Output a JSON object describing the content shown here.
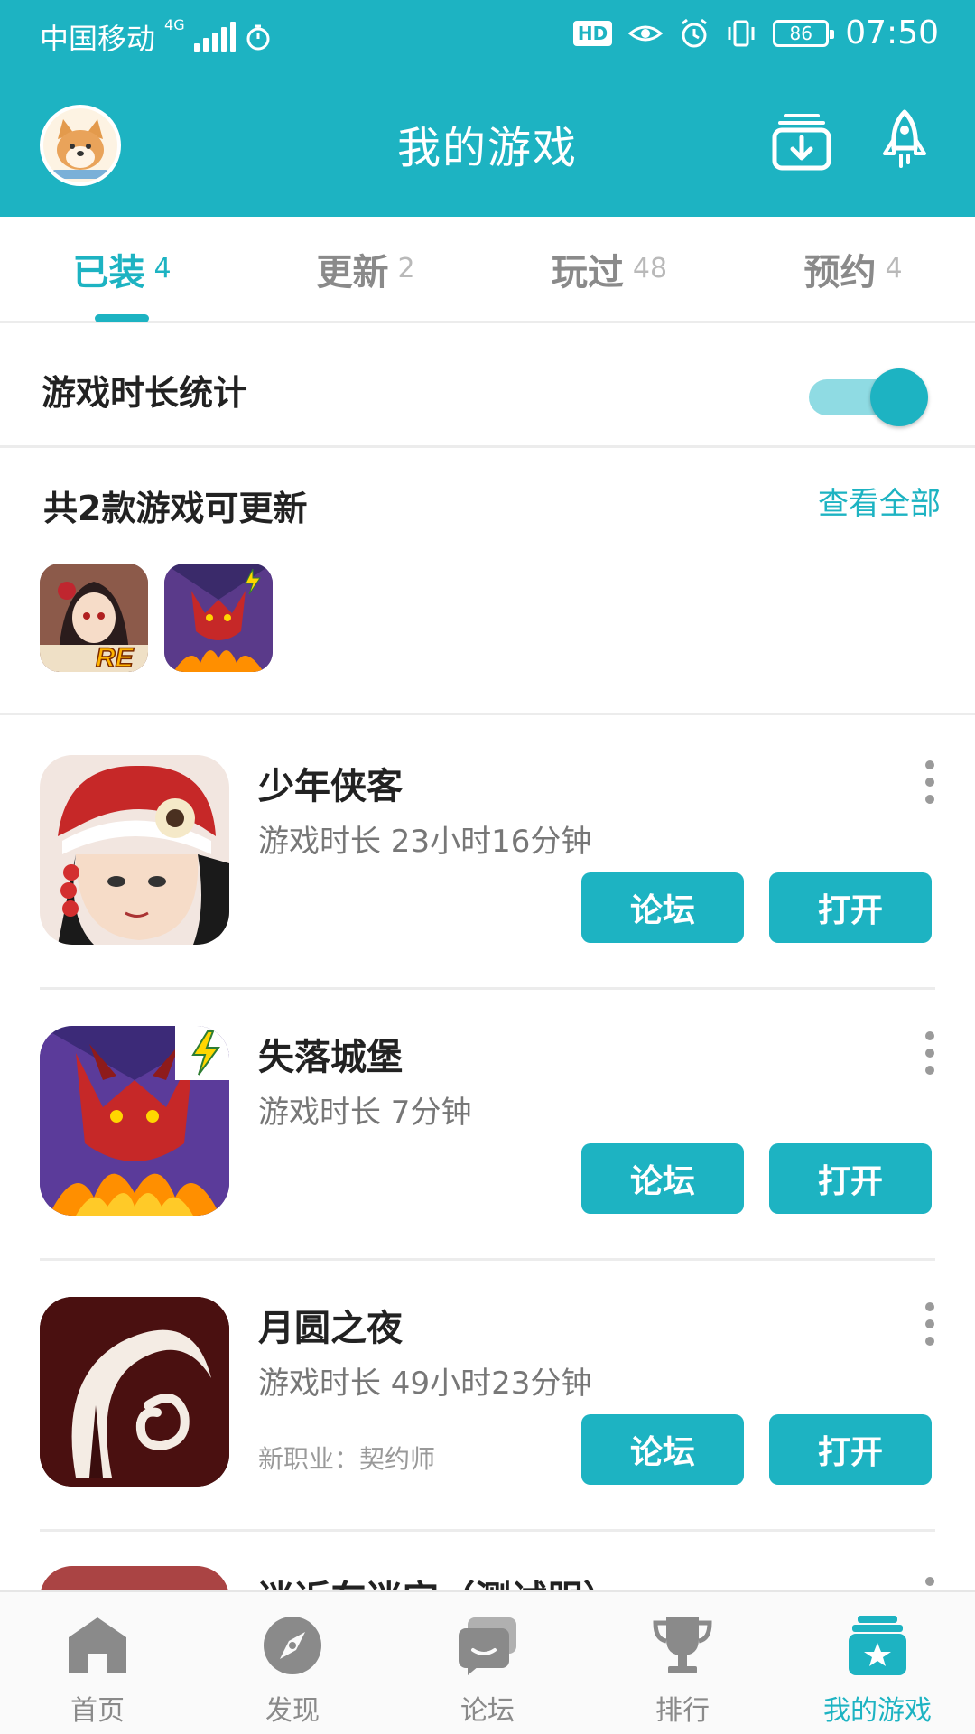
{
  "status_bar": {
    "carrier": "中国移动",
    "network": "4G",
    "hd": "HD",
    "battery": "86",
    "time": "07:50"
  },
  "header": {
    "title": "我的游戏",
    "avatar_icon": "shiba-avatar",
    "download_icon": "download-manager-icon",
    "rocket_icon": "rocket-icon"
  },
  "tabs": [
    {
      "label": "已装",
      "count": "4",
      "active": true
    },
    {
      "label": "更新",
      "count": "2",
      "active": false
    },
    {
      "label": "玩过",
      "count": "48",
      "active": false
    },
    {
      "label": "预约",
      "count": "4",
      "active": false
    }
  ],
  "toggle_row": {
    "label": "游戏时长统计",
    "enabled": true
  },
  "updates": {
    "title": "共2款游戏可更新",
    "view_all": "查看全部",
    "badge": "RE"
  },
  "games": [
    {
      "name": "少年侠客",
      "playtime": "游戏时长 23小时16分钟",
      "note": "",
      "forum_label": "论坛",
      "open_label": "打开"
    },
    {
      "name": "失落城堡",
      "playtime": "游戏时长 7分钟",
      "note": "",
      "forum_label": "论坛",
      "open_label": "打开"
    },
    {
      "name": "月圆之夜",
      "playtime": "游戏时长 49小时23分钟",
      "note": "新职业：契约师",
      "forum_label": "论坛",
      "open_label": "打开"
    }
  ],
  "partial_game": {
    "name": "迷近车迷宫（测试服）"
  },
  "bottom_nav": [
    {
      "label": "首页",
      "icon": "home-icon",
      "active": false
    },
    {
      "label": "发现",
      "icon": "compass-icon",
      "active": false
    },
    {
      "label": "论坛",
      "icon": "forum-icon",
      "active": false
    },
    {
      "label": "排行",
      "icon": "trophy-icon",
      "active": false
    },
    {
      "label": "我的游戏",
      "icon": "my-games-icon",
      "active": true
    }
  ],
  "colors": {
    "accent": "#1db3c2",
    "toggle_track": "#8fdbe3",
    "inactive": "#8a8a8a"
  }
}
